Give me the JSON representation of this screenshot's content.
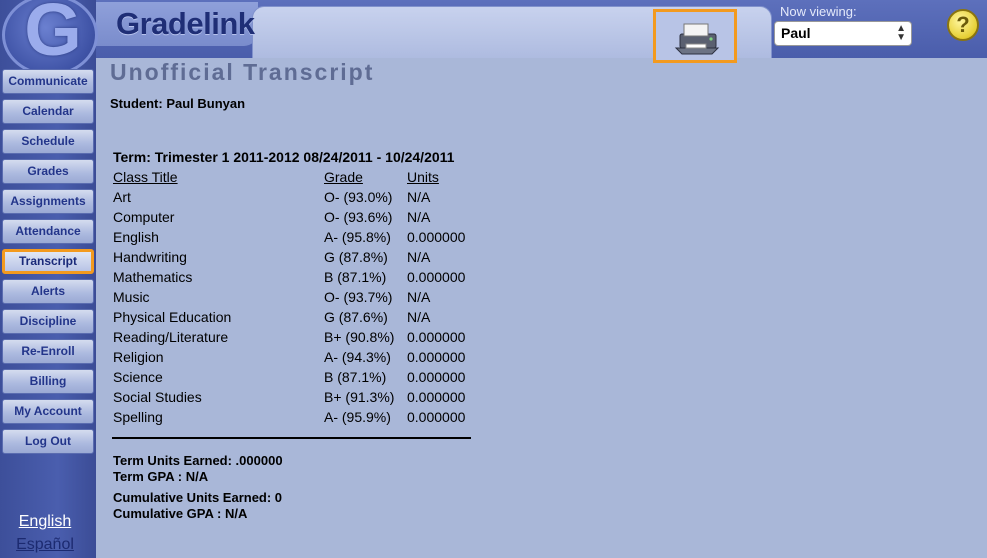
{
  "app": {
    "logo_letter": "G",
    "title": "Gradelink"
  },
  "header": {
    "now_viewing_label": "Now viewing:",
    "selected_student": "Paul",
    "help_label": "?"
  },
  "sidebar": {
    "items": [
      {
        "label": "Communicate"
      },
      {
        "label": "Calendar"
      },
      {
        "label": "Schedule"
      },
      {
        "label": "Grades"
      },
      {
        "label": "Assignments"
      },
      {
        "label": "Attendance"
      },
      {
        "label": "Transcript",
        "active": true
      },
      {
        "label": "Alerts"
      },
      {
        "label": "Discipline"
      },
      {
        "label": "Re-Enroll"
      },
      {
        "label": "Billing"
      },
      {
        "label": "My Account"
      },
      {
        "label": "Log Out"
      }
    ],
    "languages": [
      "English",
      "Español"
    ]
  },
  "main": {
    "heading": "Unofficial Transcript",
    "student": "Student: Paul Bunyan",
    "term": "Term:  Trimester 1 2011-2012 08/24/2011 - 10/24/2011",
    "columns": [
      "Class Title",
      "Grade",
      "Units"
    ],
    "rows": [
      [
        "Art",
        "O- (93.0%)",
        "N/A"
      ],
      [
        "Computer",
        "O- (93.6%)",
        "N/A"
      ],
      [
        "English",
        "A- (95.8%)",
        "0.000000"
      ],
      [
        "Handwriting",
        "G (87.8%)",
        "N/A"
      ],
      [
        "Mathematics",
        "B (87.1%)",
        "0.000000"
      ],
      [
        "Music",
        "O- (93.7%)",
        "N/A"
      ],
      [
        "Physical Education",
        "G (87.6%)",
        "N/A"
      ],
      [
        "Reading/Literature",
        "B+ (90.8%)",
        "0.000000"
      ],
      [
        "Religion",
        "A- (94.3%)",
        "0.000000"
      ],
      [
        "Science",
        "B (87.1%)",
        "0.000000"
      ],
      [
        "Social Studies",
        "B+ (91.3%)",
        "0.000000"
      ],
      [
        "Spelling",
        "A- (95.9%)",
        "0.000000"
      ]
    ],
    "summary": {
      "term_units": "Term Units Earned: .000000",
      "term_gpa": "Term GPA :  N/A",
      "cumulative_units": "Cumulative Units Earned: 0",
      "cumulative_gpa": "Cumulative GPA : N/A"
    }
  },
  "colors": {
    "accent_highlight": "#f39a1e",
    "background": "#a9b7d8",
    "nav_text": "#23358a"
  }
}
